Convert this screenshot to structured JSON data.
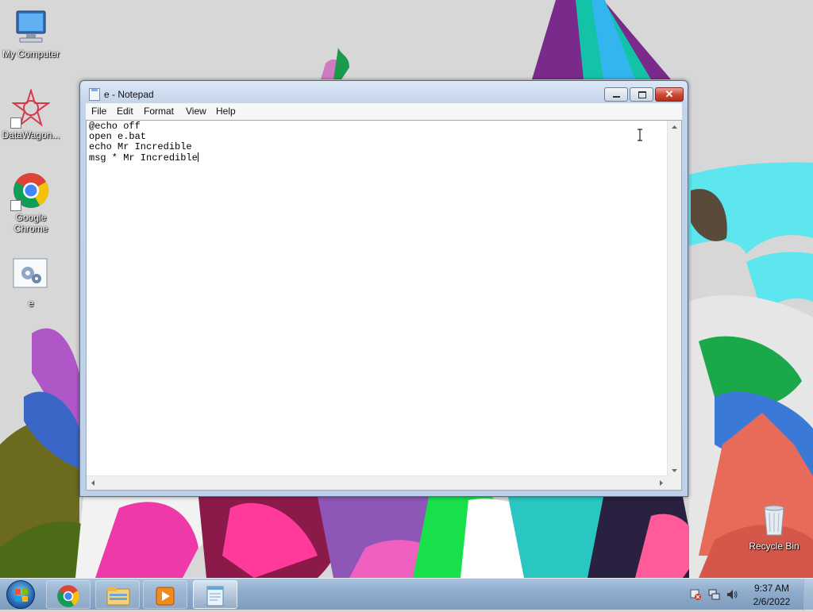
{
  "desktop": {
    "icons": [
      {
        "label": "My Computer",
        "icon": "computer-icon"
      },
      {
        "label": "DataWagon...",
        "icon": "datawagon-icon"
      },
      {
        "label": "Google Chrome",
        "icon": "chrome-icon"
      },
      {
        "label": "e",
        "icon": "batch-file-icon"
      },
      {
        "label": "Recycle Bin",
        "icon": "recycle-bin-icon"
      }
    ]
  },
  "notepad": {
    "title": "e - Notepad",
    "menu": [
      "File",
      "Edit",
      "Format",
      "View",
      "Help"
    ],
    "content": "@echo off\nopen e.bat\necho Mr Incredible\nmsg * Mr Incredible"
  },
  "taskbar": {
    "pinned": [
      "chrome-icon",
      "explorer-icon",
      "media-player-icon",
      "notepad-icon"
    ],
    "active": "notepad-icon",
    "tray_icons": [
      "action-center-icon",
      "network-icon",
      "volume-icon"
    ],
    "time": "9:37 AM",
    "date": "2/6/2022"
  },
  "colors": {
    "titlebar": "#c2d4ea",
    "close_button": "#cc4b37",
    "taskbar": "#8eabcb"
  }
}
